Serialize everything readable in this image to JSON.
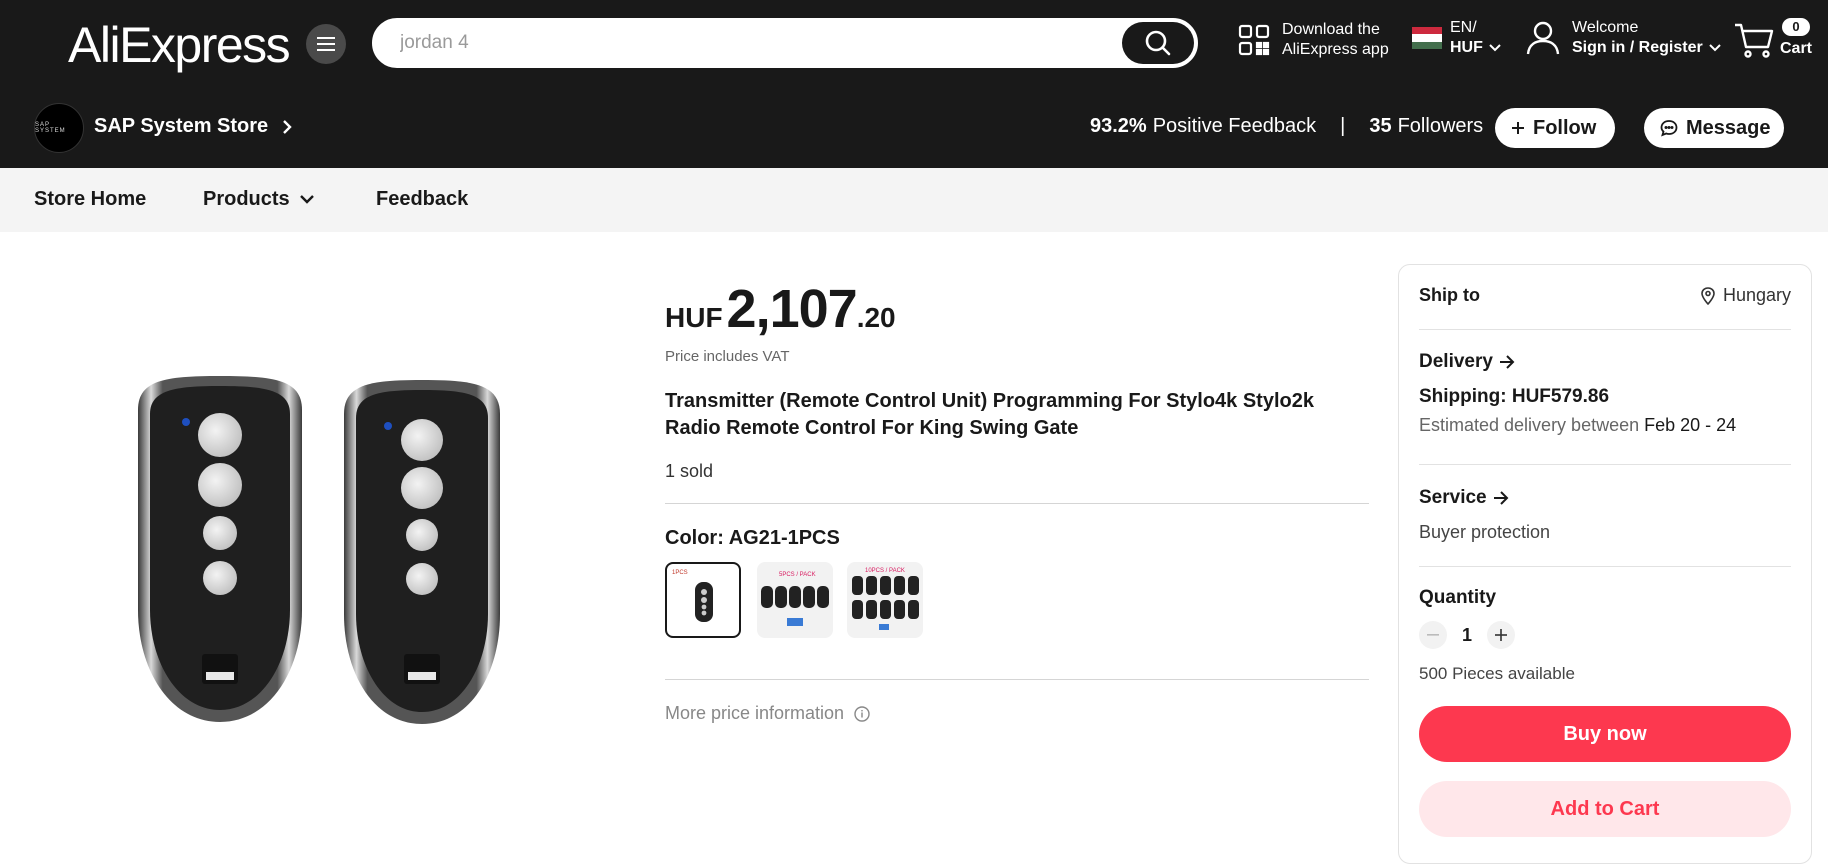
{
  "header": {
    "logo": "AliExpress",
    "search_placeholder": "jordan 4",
    "app_download": {
      "line1": "Download the",
      "line2": "AliExpress app"
    },
    "language": {
      "line1": "EN/",
      "line2": "HUF"
    },
    "account": {
      "line1": "Welcome",
      "line2": "Sign in / Register"
    },
    "cart": {
      "count": "0",
      "label": "Cart"
    }
  },
  "store": {
    "logo_text": "SAP SYSTEM",
    "name": "SAP System Store",
    "feedback_pct": "93.2%",
    "feedback_label": "Positive Feedback",
    "separator": "|",
    "followers_count": "35",
    "followers_label": "Followers",
    "follow_label": "Follow",
    "message_label": "Message"
  },
  "store_nav": {
    "home": "Store Home",
    "products": "Products",
    "feedback": "Feedback"
  },
  "product": {
    "price_currency": "HUF",
    "price_main": "2,107",
    "price_decimal": ".20",
    "vat_note": "Price includes VAT",
    "title": "Transmitter (Remote Control Unit) Programming For Stylo4k Stylo2k Radio Remote Control For King Swing Gate",
    "sold": "1 sold",
    "color_label": "Color: AG21-1PCS",
    "swatches": [
      {
        "label": "1PCS",
        "selected": true
      },
      {
        "label": "5PCS / PACK",
        "selected": false
      },
      {
        "label": "10PCS / PACK",
        "selected": false
      }
    ],
    "more_price_info": "More price information"
  },
  "panel": {
    "ship_to_label": "Ship to",
    "ship_to_country": "Hungary",
    "delivery_title": "Delivery",
    "shipping": "Shipping: HUF579.86",
    "estimated_prefix": "Estimated delivery between",
    "estimated_dates": "Feb 20 - 24",
    "service_title": "Service",
    "buyer_protection": "Buyer protection",
    "quantity_title": "Quantity",
    "quantity_value": "1",
    "available": "500 Pieces available",
    "buy_now": "Buy now",
    "add_to_cart": "Add to Cart"
  },
  "colors": {
    "header_bg": "#191919",
    "accent_red": "#fd384f",
    "add_to_cart_bg": "#ffe7ea",
    "nav_bg": "#f4f4f4"
  }
}
